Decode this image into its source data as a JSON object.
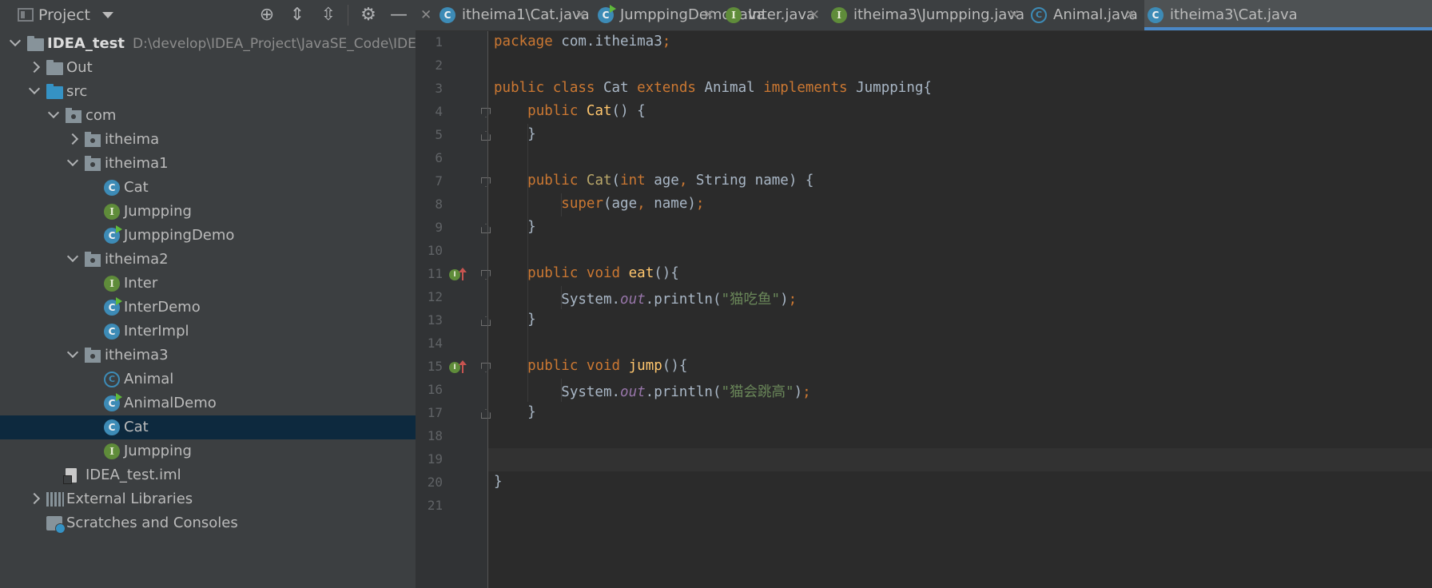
{
  "panel": {
    "title": "Project"
  },
  "tree": [
    {
      "label": "IDEA_test",
      "path": "D:\\develop\\IDEA_Project\\JavaSE_Code\\IDEA_test",
      "icon": "module",
      "indent": 0,
      "chev": "open",
      "bold": true
    },
    {
      "label": "Out",
      "icon": "folder",
      "indent": 1,
      "chev": "closed"
    },
    {
      "label": "src",
      "icon": "folder-blue",
      "indent": 1,
      "chev": "open"
    },
    {
      "label": "com",
      "icon": "package",
      "indent": 2,
      "chev": "open"
    },
    {
      "label": "itheima",
      "icon": "package",
      "indent": 3,
      "chev": "closed"
    },
    {
      "label": "itheima1",
      "icon": "package",
      "indent": 3,
      "chev": "open"
    },
    {
      "label": "Cat",
      "icon": "class",
      "indent": 4
    },
    {
      "label": "Jumpping",
      "icon": "interface",
      "indent": 4
    },
    {
      "label": "JumppingDemo",
      "icon": "class-run",
      "indent": 4
    },
    {
      "label": "itheima2",
      "icon": "package",
      "indent": 3,
      "chev": "open"
    },
    {
      "label": "Inter",
      "icon": "interface",
      "indent": 4
    },
    {
      "label": "InterDemo",
      "icon": "class-run",
      "indent": 4
    },
    {
      "label": "InterImpl",
      "icon": "class",
      "indent": 4
    },
    {
      "label": "itheima3",
      "icon": "package",
      "indent": 3,
      "chev": "open"
    },
    {
      "label": "Animal",
      "icon": "abstract-class",
      "indent": 4
    },
    {
      "label": "AnimalDemo",
      "icon": "class-run",
      "indent": 4
    },
    {
      "label": "Cat",
      "icon": "class",
      "indent": 4,
      "selected": true
    },
    {
      "label": "Jumpping",
      "icon": "interface",
      "indent": 4
    },
    {
      "label": "IDEA_test.iml",
      "icon": "iml-file",
      "indent": 2
    },
    {
      "label": "External Libraries",
      "icon": "libraries",
      "indent": 1,
      "chev": "closed",
      "shift": true
    },
    {
      "label": "Scratches and Consoles",
      "icon": "scratches",
      "indent": 1,
      "shift": true
    }
  ],
  "tabs": [
    {
      "label": "itheima1\\Cat.java",
      "icon": "class"
    },
    {
      "label": "JumppingDemo.java",
      "icon": "class-run"
    },
    {
      "label": "Inter.java",
      "icon": "interface"
    },
    {
      "label": "itheima3\\Jumpping.java",
      "icon": "interface"
    },
    {
      "label": "Animal.java",
      "icon": "abstract-class"
    },
    {
      "label": "itheima3\\Cat.java",
      "icon": "class",
      "active": true
    }
  ],
  "editor": {
    "current_line": 19,
    "lines": [
      {
        "n": "1",
        "code": "package com.itheima3;"
      },
      {
        "n": "2",
        "code": ""
      },
      {
        "n": "3",
        "code": "public class Cat extends Animal implements Jumpping{"
      },
      {
        "n": "4",
        "code": "    public Cat() {"
      },
      {
        "n": "5",
        "code": "    }"
      },
      {
        "n": "6",
        "code": ""
      },
      {
        "n": "7",
        "code": "    public Cat(int age, String name) {"
      },
      {
        "n": "8",
        "code": "        super(age, name);"
      },
      {
        "n": "9",
        "code": "    }"
      },
      {
        "n": "10",
        "code": ""
      },
      {
        "n": "11",
        "code": "    public void eat(){"
      },
      {
        "n": "12",
        "code": "        System.out.println(\"猫吃鱼\");"
      },
      {
        "n": "13",
        "code": "    }"
      },
      {
        "n": "14",
        "code": ""
      },
      {
        "n": "15",
        "code": "    public void jump(){"
      },
      {
        "n": "16",
        "code": "        System.out.println(\"猫会跳高\");"
      },
      {
        "n": "17",
        "code": "    }"
      },
      {
        "n": "18",
        "code": ""
      },
      {
        "n": "19",
        "code": ""
      },
      {
        "n": "20",
        "code": "}"
      },
      {
        "n": "21",
        "code": ""
      }
    ]
  },
  "colors": {
    "keyword": "#cc7832",
    "function": "#ffc66d",
    "string": "#6a8759",
    "static_field": "#9876aa",
    "text": "#a9b7c6",
    "selection": "#0d293e",
    "accent": "#4a88c7"
  }
}
